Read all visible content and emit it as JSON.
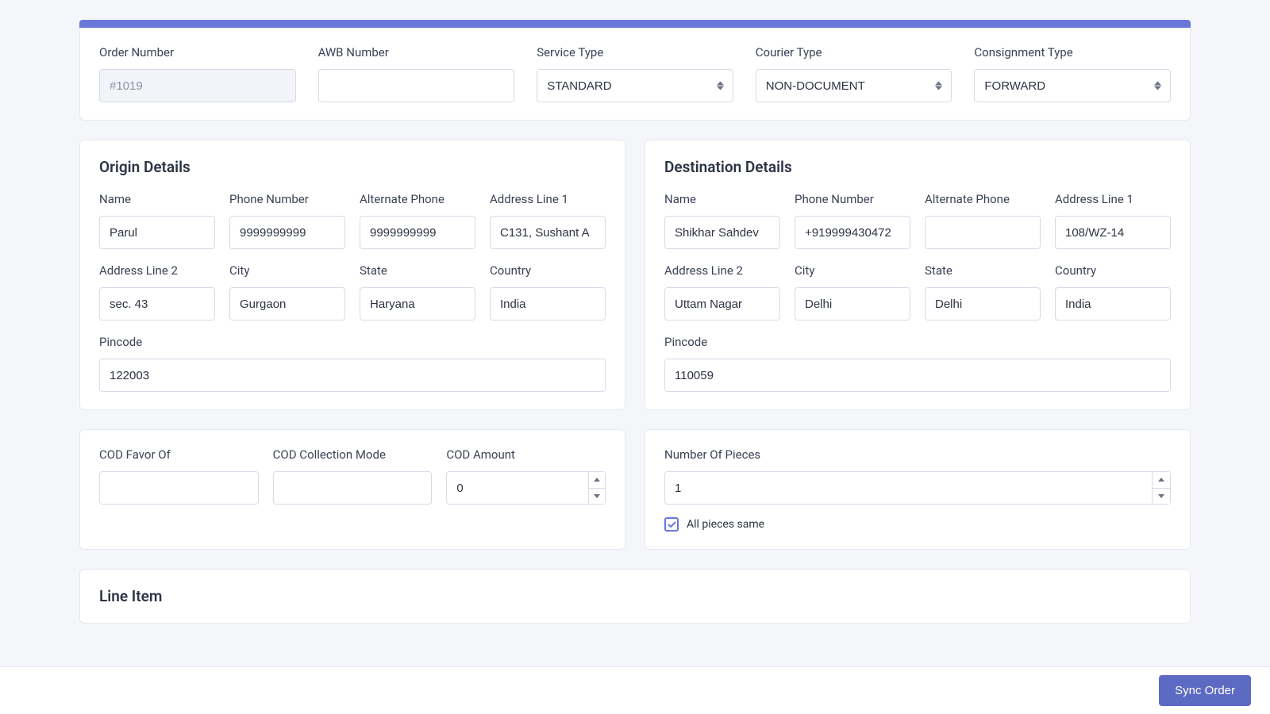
{
  "header": {
    "order_number": {
      "label": "Order Number",
      "placeholder": "#1019",
      "value": ""
    },
    "awb_number": {
      "label": "AWB Number",
      "value": ""
    },
    "service_type": {
      "label": "Service Type",
      "value": "STANDARD"
    },
    "courier_type": {
      "label": "Courier Type",
      "value": "NON-DOCUMENT"
    },
    "consignment_type": {
      "label": "Consignment Type",
      "value": "FORWARD"
    }
  },
  "origin": {
    "title": "Origin Details",
    "name": {
      "label": "Name",
      "value": "Parul"
    },
    "phone": {
      "label": "Phone Number",
      "value": "9999999999"
    },
    "alt": {
      "label": "Alternate Phone",
      "value": "9999999999"
    },
    "addr1": {
      "label": "Address Line 1",
      "value": "C131, Sushant A"
    },
    "addr2": {
      "label": "Address Line 2",
      "value": "sec. 43"
    },
    "city": {
      "label": "City",
      "value": "Gurgaon"
    },
    "state": {
      "label": "State",
      "value": "Haryana"
    },
    "country": {
      "label": "Country",
      "value": "India"
    },
    "pincode": {
      "label": "Pincode",
      "value": "122003"
    }
  },
  "destination": {
    "title": "Destination Details",
    "name": {
      "label": "Name",
      "value": "Shikhar Sahdev"
    },
    "phone": {
      "label": "Phone Number",
      "value": "+919999430472"
    },
    "alt": {
      "label": "Alternate Phone",
      "value": ""
    },
    "addr1": {
      "label": "Address Line 1",
      "value": "108/WZ-14"
    },
    "addr2": {
      "label": "Address Line 2",
      "value": "Uttam Nagar"
    },
    "city": {
      "label": "City",
      "value": "Delhi"
    },
    "state": {
      "label": "State",
      "value": "Delhi"
    },
    "country": {
      "label": "Country",
      "value": "India"
    },
    "pincode": {
      "label": "Pincode",
      "value": "110059"
    }
  },
  "cod": {
    "favor": {
      "label": "COD Favor Of",
      "value": ""
    },
    "mode": {
      "label": "COD Collection Mode",
      "value": ""
    },
    "amount": {
      "label": "COD Amount",
      "value": "0"
    }
  },
  "pieces": {
    "number": {
      "label": "Number Of Pieces",
      "value": "1"
    },
    "all_same": {
      "label": "All pieces same",
      "checked": true
    }
  },
  "line_item": {
    "title": "Line Item"
  },
  "footer": {
    "sync": "Sync Order"
  }
}
